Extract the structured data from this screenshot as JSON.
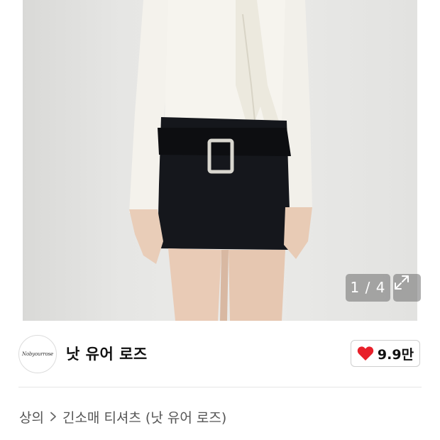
{
  "gallery": {
    "counter": "1 / 4",
    "expand_icon": "expand-arrows-icon"
  },
  "brand": {
    "logo_text": "Nobyourrose",
    "name": "낫 유어 로즈"
  },
  "like": {
    "icon": "heart-icon",
    "count": "9.9만",
    "color": "#e8202a"
  },
  "breadcrumb": {
    "category": "상의",
    "separator_icon": "chevron-right-icon",
    "title": "긴소매 티셔츠 (낫 유어 로즈)"
  }
}
